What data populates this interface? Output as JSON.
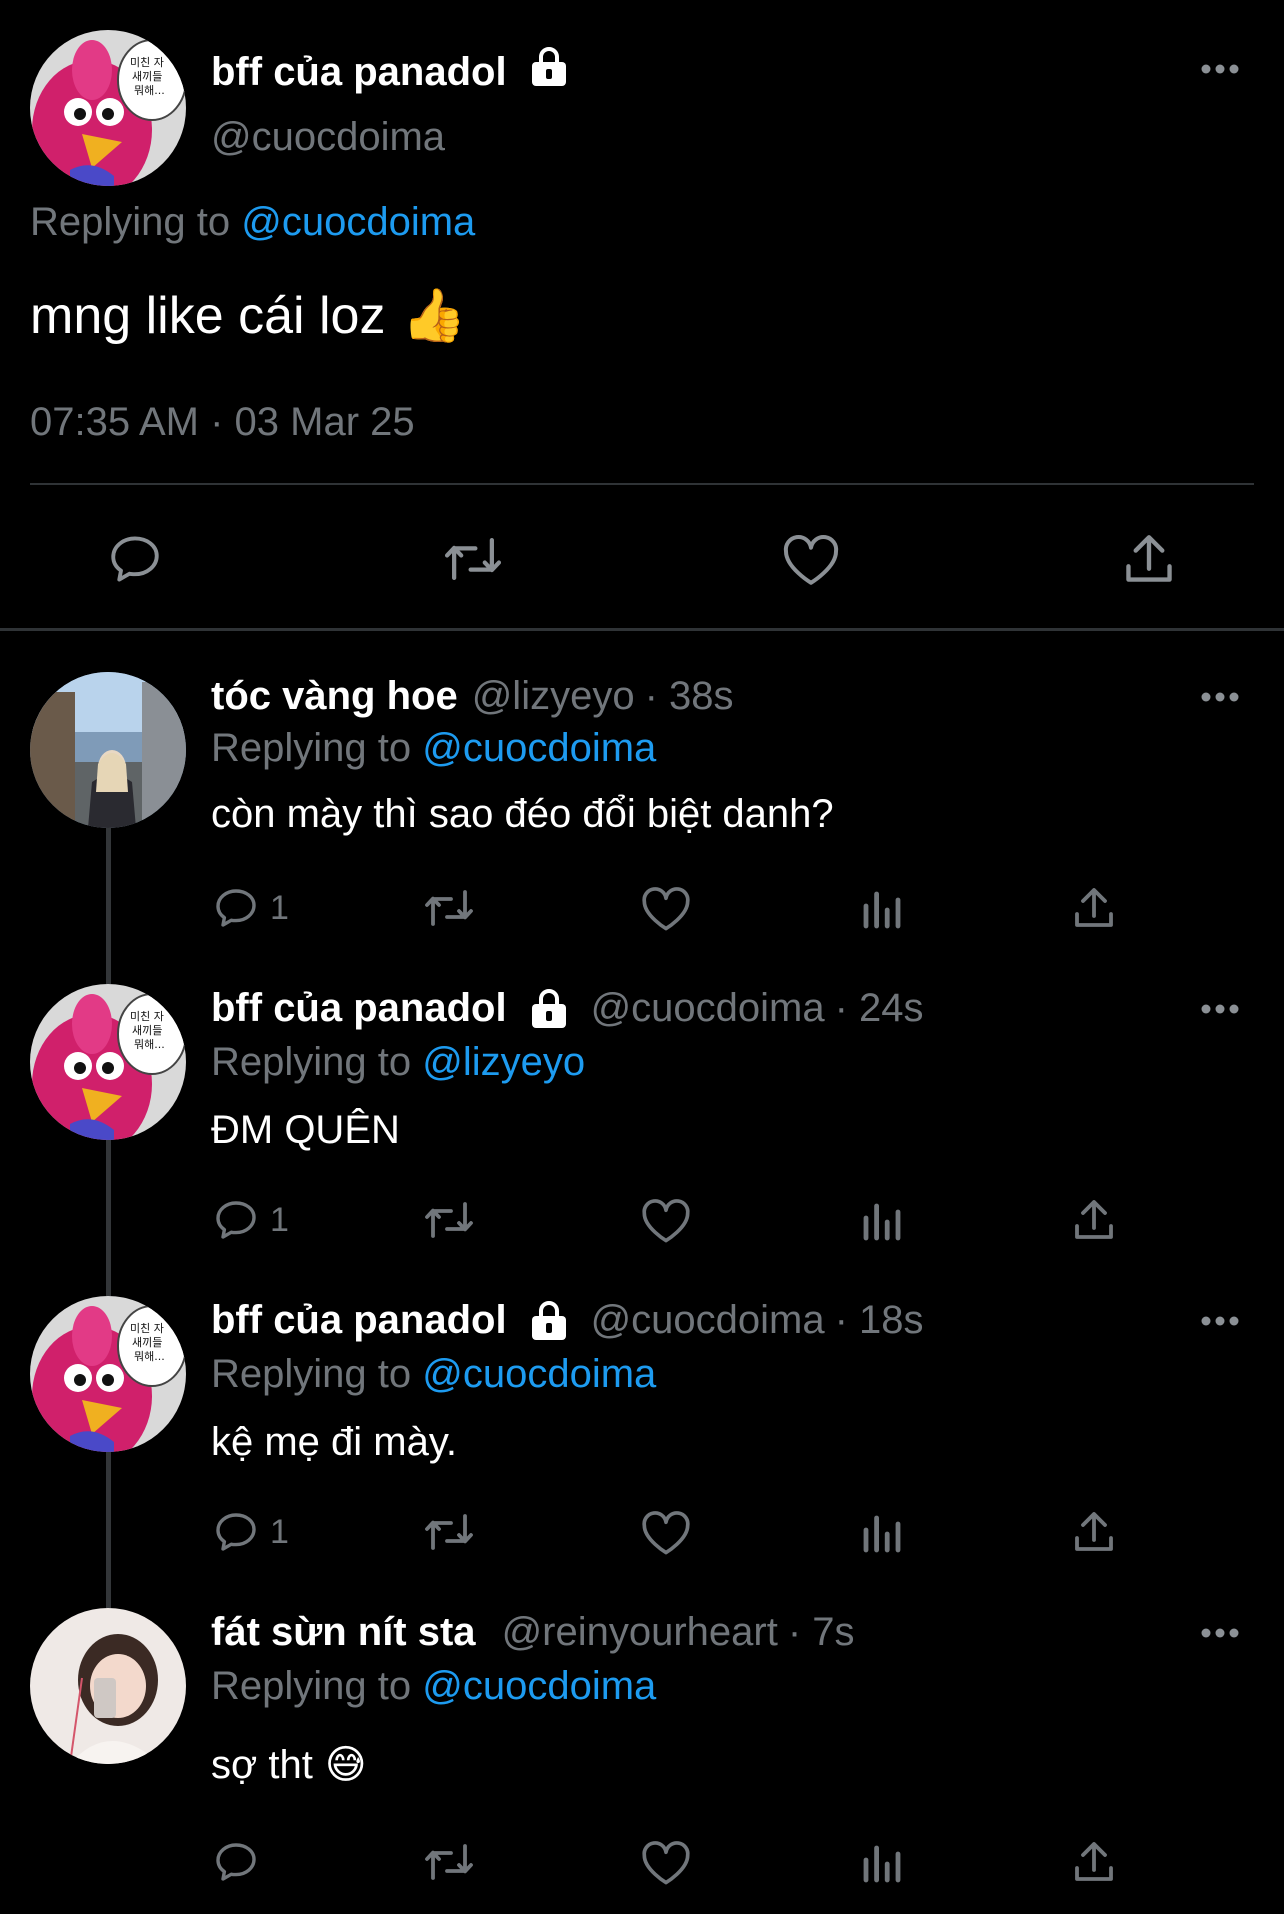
{
  "main_tweet": {
    "display_name": "bff của panadol",
    "handle": "@cuocdoima",
    "replying_prefix": "Replying to",
    "replying_to": "@cuocdoima",
    "text": "mng like cái loz",
    "emoji": "👍",
    "timestamp": "07:35 AM · 03 Mar 25"
  },
  "avatar_speech": "미친 자\n새끼들\n뭐해...",
  "replies": [
    {
      "display_name": "tóc vàng hoe",
      "handle": "@lizyeyo",
      "time": "· 38s",
      "replying_prefix": "Replying to",
      "replying_to": "@cuocdoima",
      "text": "còn mày thì sao đéo đổi biệt danh?",
      "reply_count": "1",
      "locked": false,
      "avatar": "photo-street"
    },
    {
      "display_name": "bff của panadol",
      "handle": "@cuocdoima",
      "time": "· 24s",
      "replying_prefix": "Replying to",
      "replying_to": "@lizyeyo",
      "text": "ĐM QUÊN",
      "reply_count": "1",
      "locked": true,
      "avatar": "bird-cartoon"
    },
    {
      "display_name": "bff của panadol",
      "handle": "@cuocdoima",
      "time": "· 18s",
      "replying_prefix": "Replying to",
      "replying_to": "@cuocdoima",
      "text": "kệ mẹ đi mày.",
      "reply_count": "1",
      "locked": true,
      "avatar": "bird-cartoon"
    },
    {
      "display_name": "fát sừn nít sta",
      "handle": "@reinyourheart",
      "time": "· 7s",
      "replying_prefix": "Replying to",
      "replying_to": "@cuocdoima",
      "text": "sợ tht",
      "emoji": "😅",
      "reply_count": "",
      "locked": false,
      "avatar": "photo-selfie"
    }
  ],
  "colors": {
    "background": "#000000",
    "text": "#e7e9ea",
    "muted": "#71767b",
    "link": "#1d9bf0",
    "divider": "#2f3336"
  }
}
